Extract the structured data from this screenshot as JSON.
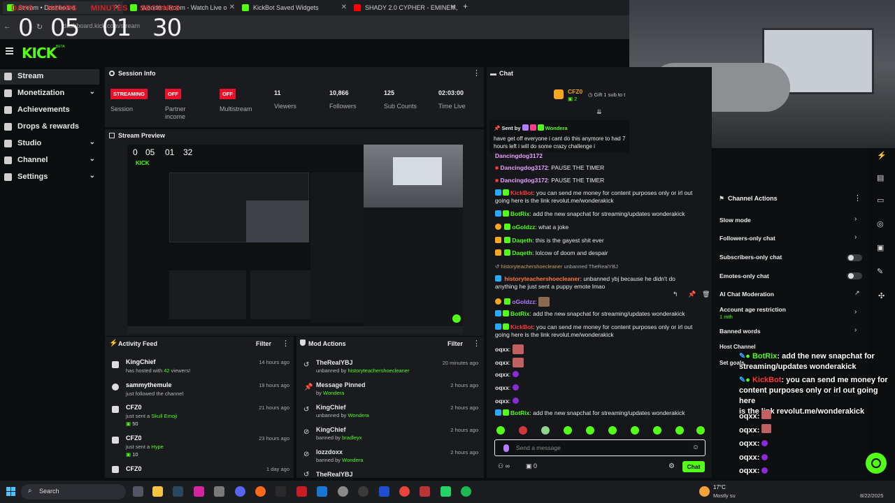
{
  "browser": {
    "tabs": [
      {
        "label": "Stream • Dashboard"
      },
      {
        "label": "Wondera Room - Watch Live o"
      },
      {
        "label": "KickBot Saved Widgets"
      },
      {
        "label": "SHADY 2.0 CYPHER - EMINEM,"
      }
    ],
    "url": "dashboard.kick.com/stream",
    "new_tab": "+"
  },
  "timer": {
    "labels": [
      "DAYS",
      "HOURS",
      "MINUTES",
      "SECONDS"
    ],
    "values": [
      "0",
      "05",
      "01",
      "30"
    ]
  },
  "header": {
    "logo": "KICK",
    "logo_tag": "BETA"
  },
  "sidebar": {
    "items": [
      {
        "label": "Stream",
        "chevron": ""
      },
      {
        "label": "Monetization",
        "chevron": "⌄"
      },
      {
        "label": "Achievements",
        "chevron": ""
      },
      {
        "label": "Drops & rewards",
        "chevron": ""
      },
      {
        "label": "Studio",
        "chevron": "⌄"
      },
      {
        "label": "Channel",
        "chevron": "⌄"
      },
      {
        "label": "Settings",
        "chevron": "⌄"
      }
    ]
  },
  "session": {
    "title": "Session Info",
    "stats": [
      {
        "badge": "STREAMING",
        "label": "Session"
      },
      {
        "badge": "OFF",
        "label": "Partner income"
      },
      {
        "badge": "OFF",
        "label": "Multistream"
      },
      {
        "value": "11",
        "label": "Viewers"
      },
      {
        "value": "10,866",
        "label": "Followers"
      },
      {
        "value": "125",
        "label": "Sub Counts"
      },
      {
        "value": "02:03:00",
        "label": "Time Live"
      }
    ]
  },
  "preview": {
    "title": "Stream Preview",
    "timer_values": [
      "0",
      "05",
      "01",
      "32"
    ],
    "logo": "KICK"
  },
  "activity": {
    "title": "Activity Feed",
    "filter": "Filter",
    "items": [
      {
        "name": "KingChief",
        "sub": "has hosted with",
        "hl": "42",
        "sub2": "viewers!",
        "time": "14 hours ago"
      },
      {
        "name": "sammythemule",
        "sub": "just followed the channel",
        "hl": "",
        "sub2": "",
        "time": "19 hours ago"
      },
      {
        "name": "CFZ0",
        "sub": "just sent a",
        "hl": "Skull Emoji",
        "sub2": "",
        "extra": "50",
        "time": "21 hours ago"
      },
      {
        "name": "CFZ0",
        "sub": "just sent a",
        "hl": "Hype",
        "sub2": "",
        "extra": "10",
        "time": "23 hours ago"
      },
      {
        "name": "CFZ0",
        "sub": "",
        "hl": "",
        "sub2": "",
        "time": "1 day ago"
      }
    ]
  },
  "mod": {
    "title": "Mod Actions",
    "filter": "Filter",
    "items": [
      {
        "name": "TheRealYBJ",
        "sub": "unbanned by",
        "by": "historyteachershoecleaner",
        "time": "20 minutes ago"
      },
      {
        "name": "Message Pinned",
        "sub": "by",
        "by": "Wondera",
        "time": "2 hours ago"
      },
      {
        "name": "KingChief",
        "sub": "unbanned by",
        "by": "Wondera",
        "time": "2 hours ago"
      },
      {
        "name": "KingChief",
        "sub": "banned by",
        "by": "bradleyx",
        "time": "2 hours ago"
      },
      {
        "name": "lozzdoxx",
        "sub": "banned by",
        "by": "Wondera",
        "time": "2 hours ago"
      },
      {
        "name": "TheRealYBJ",
        "sub": "",
        "by": "",
        "time": ""
      }
    ]
  },
  "chat": {
    "title": "Chat",
    "gifter": "CFZ0",
    "gifter_count": "2",
    "gift_text": "Gift 1 sub to t",
    "pinned_by_label": "Sent by",
    "pinned_user": "Wondera",
    "pinned_text": "have get off everyone i cant do this anymore to had 7 hours left i will do some crazy challenge i",
    "messages": [
      {
        "user": "Dancingdog3172",
        "text": "PAUSE THE TIMER",
        "color": "#e9a0ff"
      },
      {
        "user": "Dancingdog3172",
        "text": "PAUSE THE TIMER",
        "color": "#e9a0ff"
      },
      {
        "user": "KickBot",
        "text": "you can send me money for content purposes only or irl out",
        "text2": "going here is the link revolut.me/wonderakick",
        "color": "#ff3b3b"
      },
      {
        "user": "BotRix",
        "text": "add the new snapchat for streaming/updates wonderakick",
        "color": "#53fc18"
      },
      {
        "user": "oGoldzz",
        "text": "what a joke",
        "color": "#53fc18"
      },
      {
        "user": "Daqeth",
        "text": "this is the gayest shit ever",
        "color": "#53fc18"
      },
      {
        "user": "Daqeth",
        "text": "lolcow of doom and despair",
        "color": "#53fc18"
      },
      {
        "user": "historyteachershoecleaner",
        "text": "unbanned TheRealYBJ",
        "color": "#c9a066",
        "system": true
      },
      {
        "user": "historyteachershoecleaner",
        "text": "unbanned ybj because he didn't do",
        "text2": "anything he just sent a puppy emote lmao",
        "color": "#ff7a2e"
      },
      {
        "user": "oGoldzz",
        "text": "",
        "color": "#53fc18"
      },
      {
        "user": "BotRix",
        "text": "add the new snapchat for streaming/updates wonderakick",
        "color": "#53fc18"
      },
      {
        "user": "KickBot",
        "text": "you can send me money for content purposes only or irl out",
        "text2": "going here is the link revolut.me/wonderakick",
        "color": "#ff3b3b"
      },
      {
        "user": "oqxx",
        "text": "",
        "color": "#ddd"
      },
      {
        "user": "oqxx",
        "text": "",
        "color": "#ddd"
      },
      {
        "user": "oqxx",
        "text": "",
        "color": "#ddd"
      },
      {
        "user": "oqxx",
        "text": "",
        "color": "#ddd"
      },
      {
        "user": "oqxx",
        "text": "",
        "color": "#ddd"
      },
      {
        "user": "BotRix",
        "text": "add the new snapchat for streaming/updates wonderakick",
        "color": "#53fc18"
      }
    ],
    "input_placeholder": "Send a message",
    "send_label": "Chat",
    "footer_count": "0"
  },
  "channel_actions": {
    "title": "Channel Actions",
    "items": [
      {
        "label": "Slow mode",
        "control": "chevron"
      },
      {
        "label": "Followers-only chat",
        "control": "chevron"
      },
      {
        "label": "Subscribers-only chat",
        "control": "toggle"
      },
      {
        "label": "Emotes-only chat",
        "control": "toggle"
      },
      {
        "label": "AI Chat Moderation",
        "control": "external"
      },
      {
        "label": "Account age restriction",
        "sub": "1 mth",
        "control": "chevron"
      },
      {
        "label": "Banned words",
        "control": "chevron"
      },
      {
        "label": "Host Channel",
        "control": ""
      },
      {
        "label": "Set goals",
        "control": ""
      }
    ]
  },
  "overlay_chat": {
    "lines": [
      {
        "user": "BotRix",
        "text": "add the new snapchat for",
        "text2": "streaming/updates wonderakick",
        "color": "#53fc18"
      },
      {
        "user": "KickBot",
        "text": "you can send me money for",
        "text2": "content purposes only or irl out going here",
        "text3": "is the link revolut.me/wonderakick",
        "color": "#ff3b3b"
      },
      {
        "user": "oqxx",
        "text": "",
        "color": "#fff"
      },
      {
        "user": "oqxx",
        "text": "",
        "color": "#fff"
      },
      {
        "user": "oqxx",
        "text": "",
        "color": "#fff"
      },
      {
        "user": "oqxx",
        "text": "",
        "color": "#fff"
      },
      {
        "user": "oqxx",
        "text": "",
        "color": "#fff"
      },
      {
        "user": "BotRix",
        "text": "add the new snapchat for",
        "text2": "streaming/updates wonderakick",
        "color": "#53fc18"
      }
    ]
  },
  "taskbar": {
    "search_label": "Search",
    "weather_temp": "17°C",
    "weather_desc": "Mostly su",
    "date": "8/22/2025"
  },
  "colors": {
    "kick_green": "#53fc18",
    "panel": "#191b1f",
    "bg": "#0b0e0f",
    "badge_red": "#e9112a"
  }
}
